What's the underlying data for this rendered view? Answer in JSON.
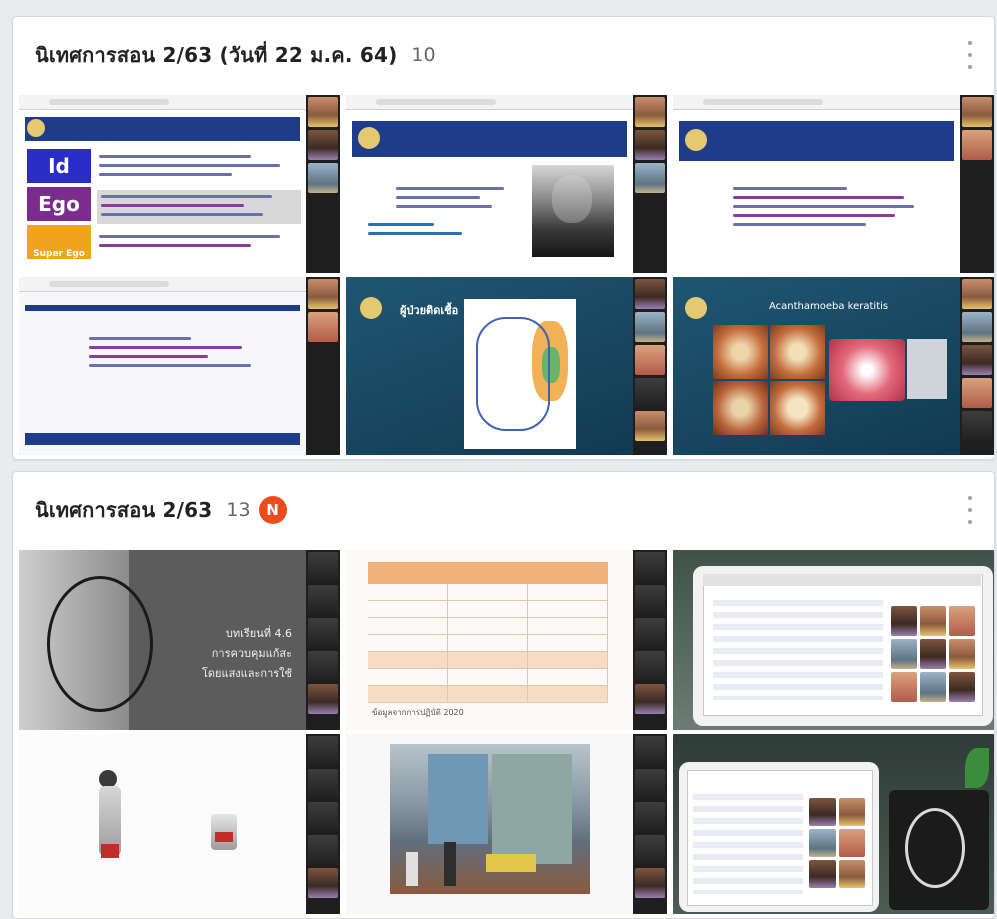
{
  "groups": [
    {
      "title": "นิเทศการสอน 2/63 (วันที่ 22 ม.ค. 64)",
      "count": "10"
    },
    {
      "title": "นิเทศการสอน 2/63",
      "count": "13",
      "badge": "N"
    }
  ],
  "slides": {
    "id_label": "Id",
    "ego_label": "Ego",
    "superego_label": "Super Ego",
    "physiology_title": "ผู้ป่วยติดเชื้อ",
    "eye_title": "Acanthamoeba keratitis",
    "lesson_title": "บทเรียนที่ 4.6",
    "lesson_line2": "การควบคุมแก้สะ",
    "lesson_line3": "โดยแสงและการใช้",
    "table_caption": "ข้อมูลจากการปฏิบัติ 2020"
  },
  "colors": {
    "accent": "#ea4c1c",
    "slide_header": "#1f3c88",
    "dark_slide": "#1e4a6a"
  }
}
